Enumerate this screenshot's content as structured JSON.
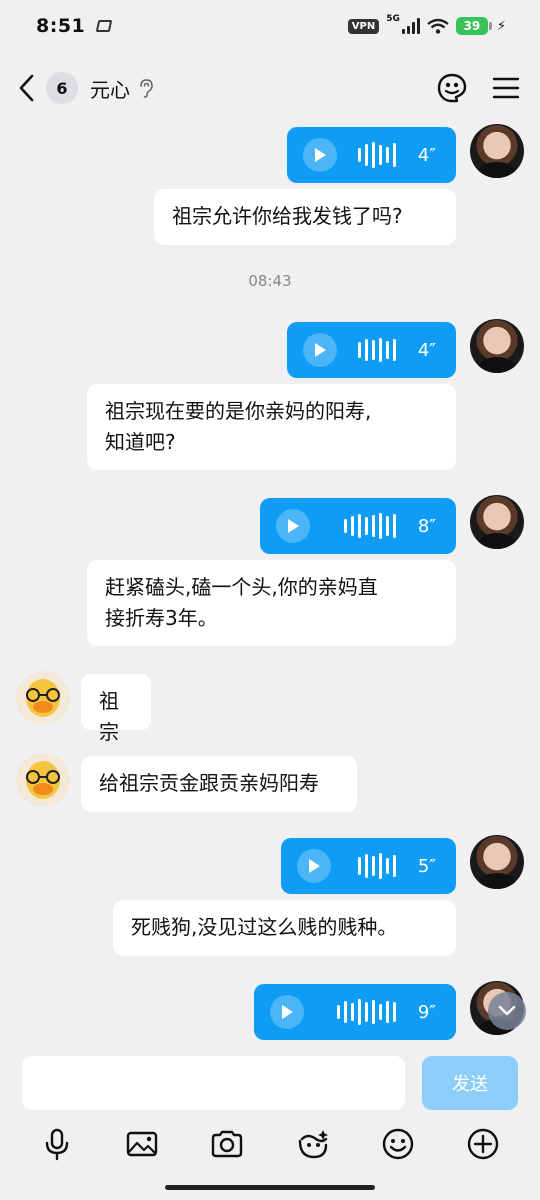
{
  "status_bar": {
    "time": "8:51",
    "vpn": "VPN",
    "network": "5G",
    "battery": "39"
  },
  "header": {
    "unread_count": "6",
    "contact_name": "元心"
  },
  "messages": {
    "m1_voice_duration": "4″",
    "m2_text": "祖宗允许你给我发钱了吗?",
    "timestamp": "08:43",
    "m3_voice_duration": "4″",
    "m4_text_line1": "祖宗现在要的是你亲妈的阳寿,",
    "m4_text_line2": "知道吧?",
    "m5_voice_duration": "8″",
    "m6_text_line1": "赶紧磕头,磕一个头,你的亲妈直",
    "m6_text_line2": "接折寿3年。",
    "m7_text": "祖宗",
    "m8_text": "给祖宗贡金跟贡亲妈阳寿",
    "m9_voice_duration": "5″",
    "m10_text": "死贱狗,没见过这么贱的贱种。",
    "m11_voice_duration": "9″"
  },
  "input": {
    "placeholder": "",
    "send_label": "发送"
  },
  "colors": {
    "voice_bubble": "#0f9cf5",
    "send_disabled": "#8ccdf9",
    "background": "#f0f0f3"
  }
}
